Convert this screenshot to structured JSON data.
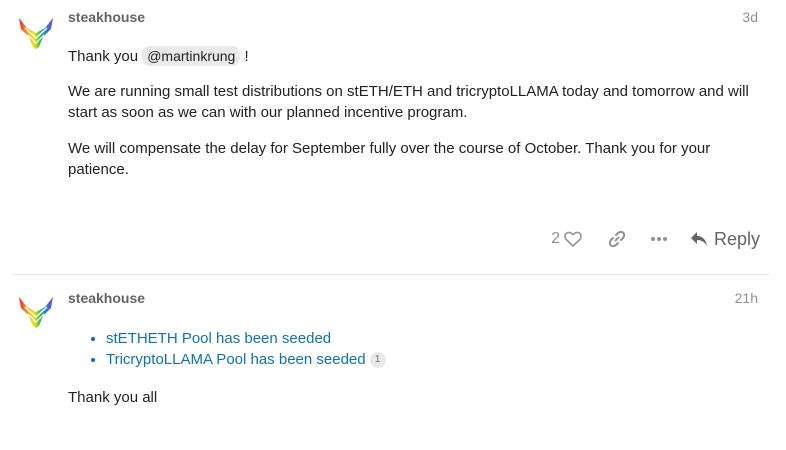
{
  "posts": [
    {
      "username": "steakhouse",
      "date": "3d",
      "thanks_prefix": "Thank you",
      "mention": "@martinkrung",
      "thanks_suffix": "!",
      "paragraph_1": "We are running small test distributions on stETH/ETH and tricryptoLLAMA today and tomorrow and will start as soon as we can with our planned incentive program.",
      "paragraph_2": "We will compensate the delay for September fully over the course of October. Thank you for your patience.",
      "like_count": "2",
      "reply_label": "Reply"
    },
    {
      "username": "steakhouse",
      "date": "21h",
      "links": [
        {
          "text": "stETHETH Pool has been seeded",
          "clicks": ""
        },
        {
          "text": "TricryptoLLAMA Pool has been seeded",
          "clicks": "1"
        }
      ],
      "closing": "Thank you all"
    }
  ],
  "colors": {
    "link": "#0e73b0",
    "meta": "#919191",
    "username": "#646464"
  },
  "icons": [
    "steakhouse-logo",
    "heart-icon",
    "link-icon",
    "more-icon",
    "reply-icon"
  ]
}
